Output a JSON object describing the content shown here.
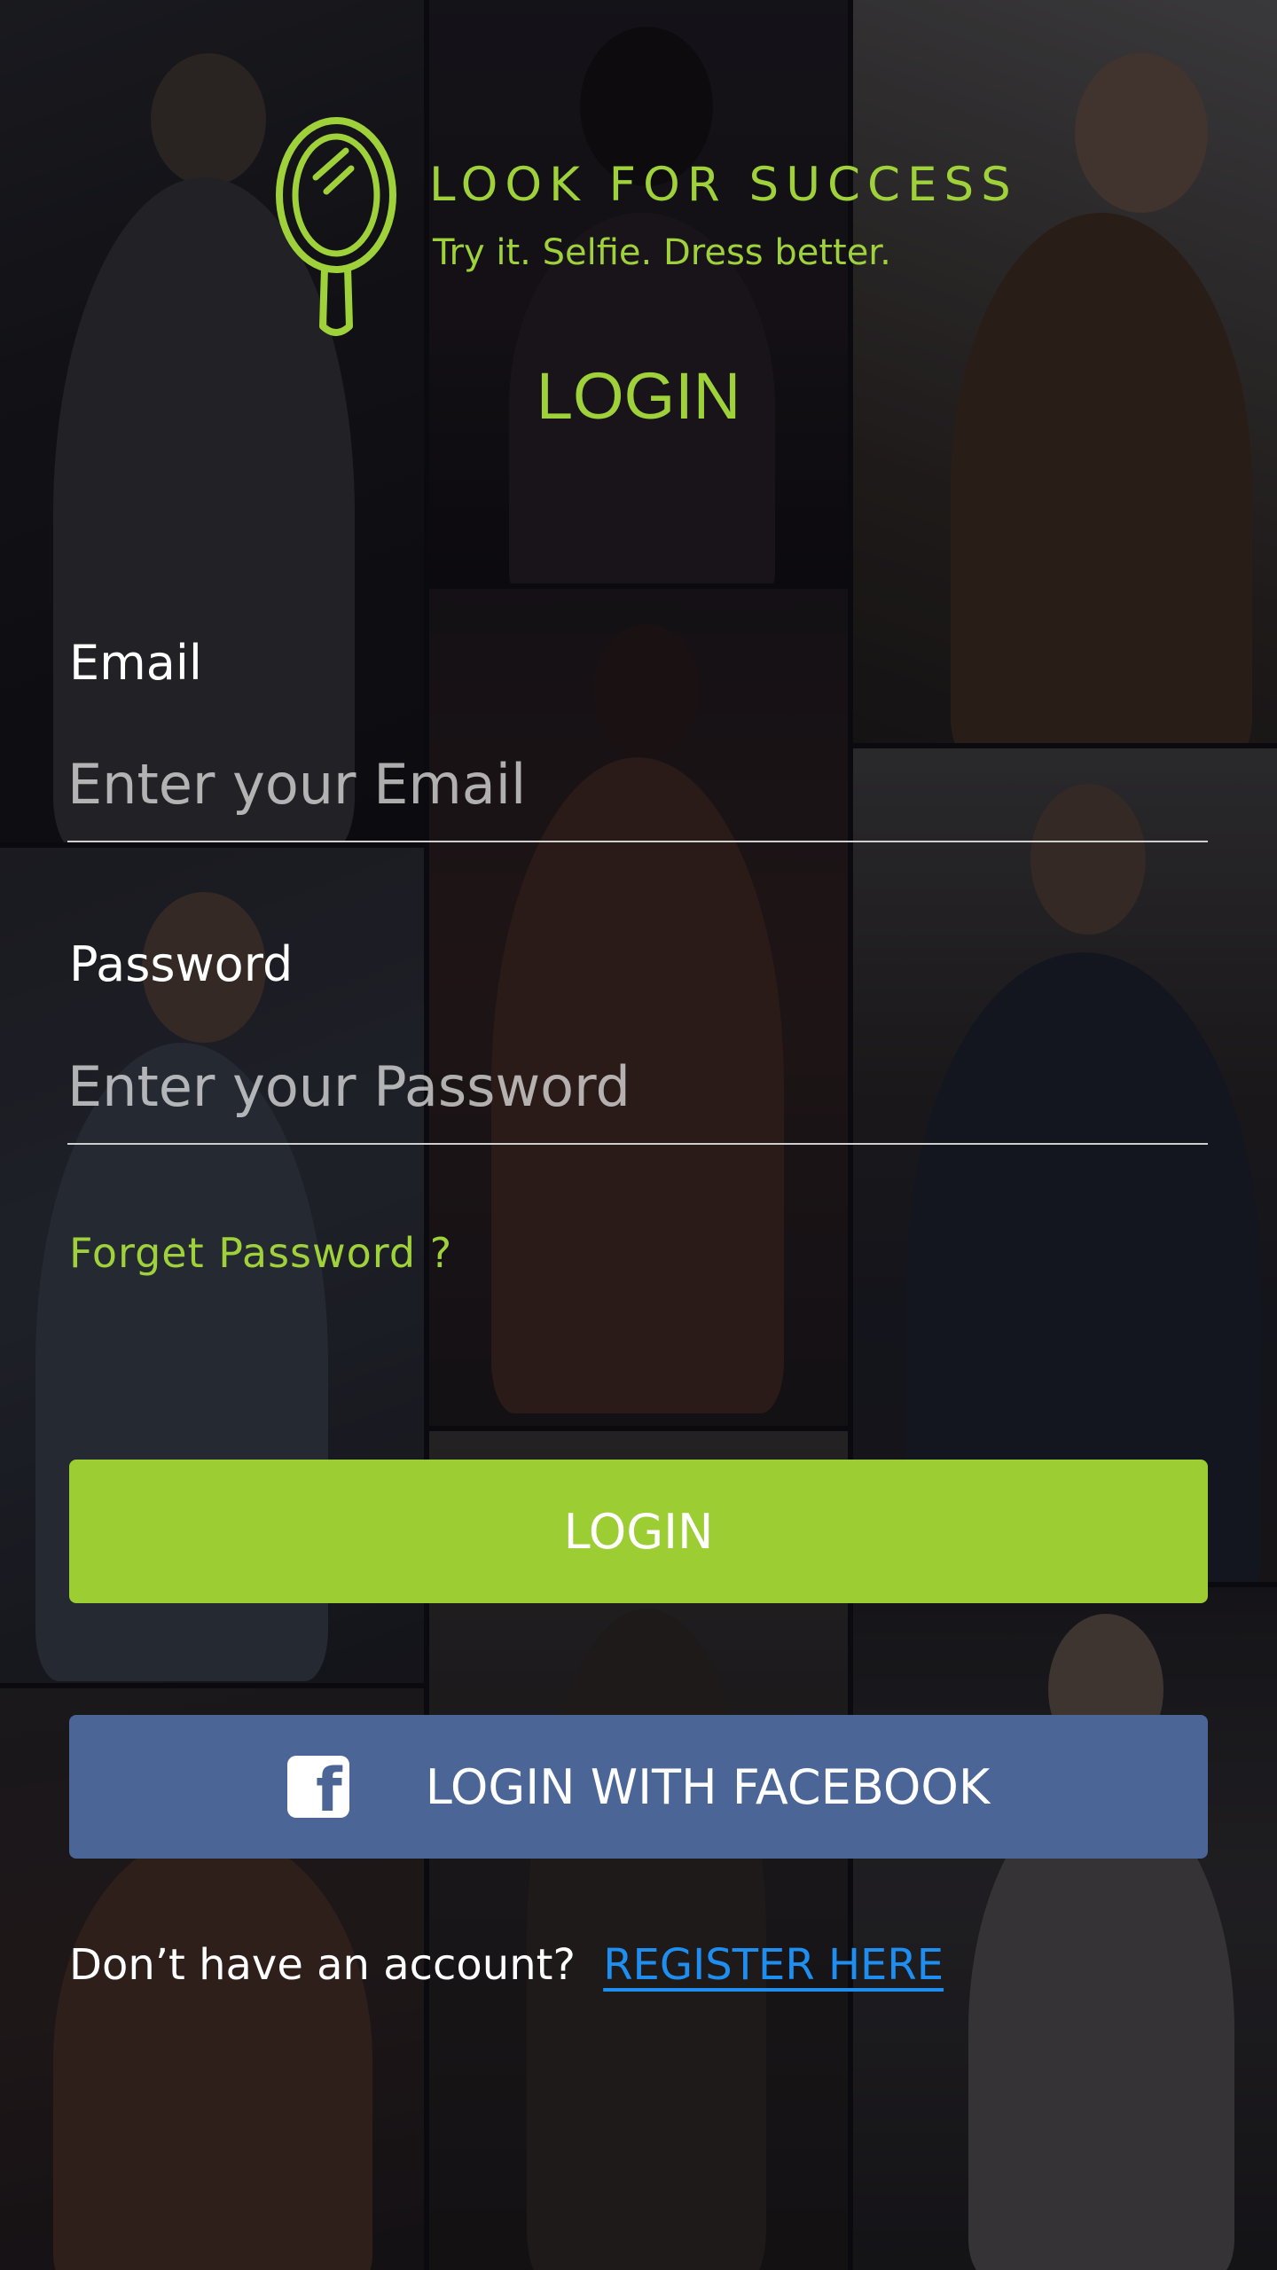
{
  "brand": {
    "title": "LOOK FOR SUCCESS",
    "tagline": "Try it. Selfie. Dress better.",
    "logo_icon": "hand-mirror-icon",
    "accent_color": "#9fd13a"
  },
  "page": {
    "title": "LOGIN"
  },
  "form": {
    "email": {
      "label": "Email",
      "placeholder": "Enter your Email",
      "value": ""
    },
    "password": {
      "label": "Password",
      "placeholder": "Enter your Password",
      "value": ""
    },
    "forgot_password": "Forget Password ?"
  },
  "actions": {
    "login_label": "LOGIN",
    "login_color": "#9ccd33",
    "facebook_label": "LOGIN WITH FACEBOOK",
    "facebook_icon": "facebook-icon",
    "facebook_color": "#4a6596"
  },
  "footer": {
    "question": "Don’t have an account?",
    "register_link": "REGISTER HERE",
    "link_color": "#1e8ef0"
  }
}
